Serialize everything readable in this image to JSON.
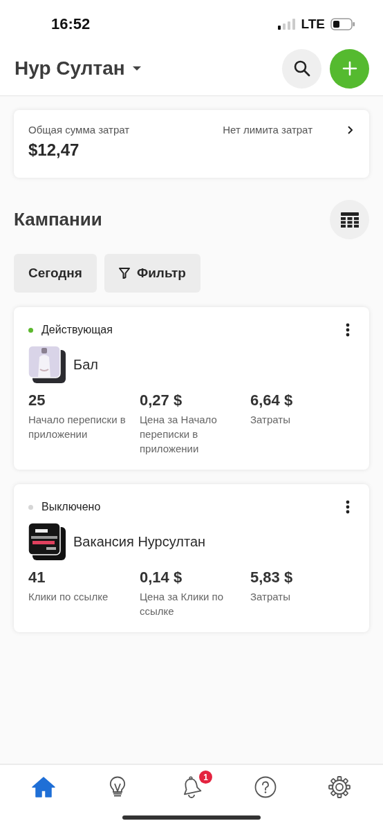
{
  "status_bar": {
    "time": "16:52",
    "network": "LTE"
  },
  "header": {
    "title": "Нур Султан"
  },
  "summary": {
    "label": "Общая сумма затрат",
    "amount": "$12,47",
    "limit": "Нет лимита затрат"
  },
  "section_title": "Кампании",
  "filters": [
    {
      "kind": "plain",
      "label": "Сегодня"
    },
    {
      "kind": "filter",
      "label": "Фильтр"
    }
  ],
  "campaigns": [
    {
      "status": "Действующая",
      "color": "#5cb82e",
      "name": "Бал",
      "metrics": [
        {
          "value": "25",
          "label": "Начало переписки в приложении"
        },
        {
          "value": "0,27 $",
          "label": "Цена за Начало переписки в приложении"
        },
        {
          "value": "6,64 $",
          "label": "Затраты"
        }
      ]
    },
    {
      "status": "Выключено",
      "color": "#d6d6d6",
      "name": "Вакансия Нурсултан",
      "metrics": [
        {
          "value": "41",
          "label": "Клики по ссылке"
        },
        {
          "value": "0,14 $",
          "label": "Цена за Клики по ссылке"
        },
        {
          "value": "5,83 $",
          "label": "Затраты"
        }
      ]
    }
  ],
  "nav": [
    {
      "kind": "home",
      "selected": true
    },
    {
      "kind": "bulb",
      "selected": false
    },
    {
      "kind": "bell",
      "selected": false,
      "badge": "1"
    },
    {
      "kind": "help",
      "selected": false
    },
    {
      "kind": "settings",
      "selected": false
    }
  ]
}
